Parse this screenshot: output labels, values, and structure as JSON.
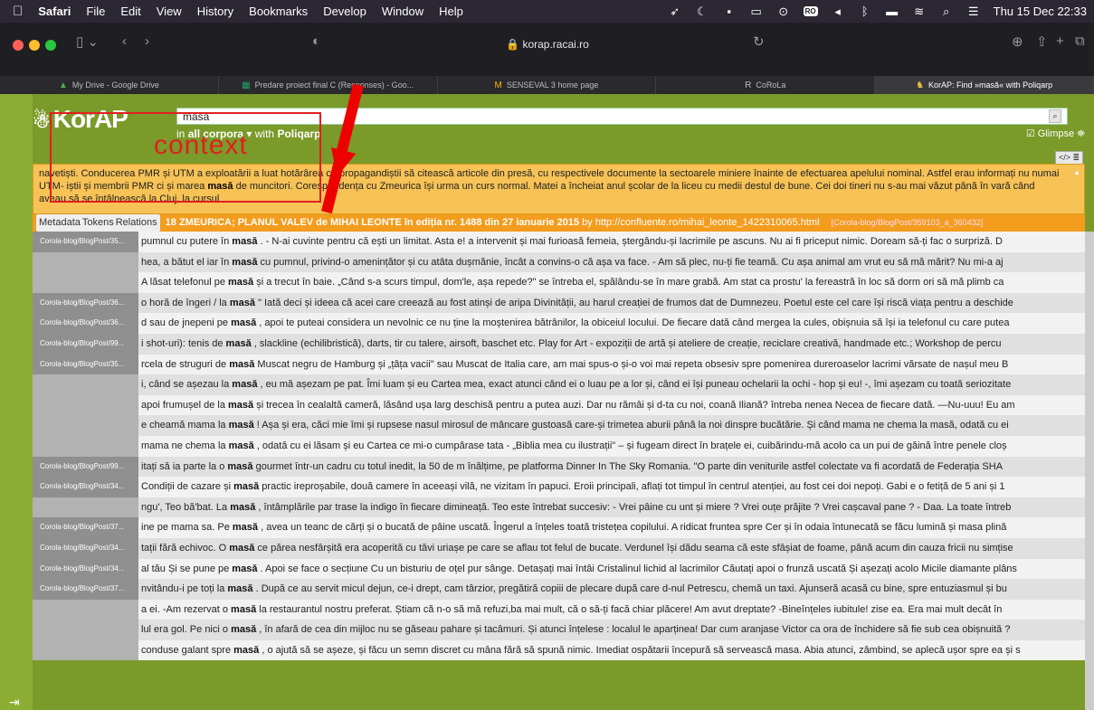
{
  "menubar": {
    "app": "Safari",
    "items": [
      "File",
      "Edit",
      "View",
      "History",
      "Bookmarks",
      "Develop",
      "Window",
      "Help"
    ],
    "clock": "Thu 15 Dec 22:33",
    "ro_badge": "RO"
  },
  "browser": {
    "url": "korap.racai.ro",
    "tabs": [
      {
        "label": "My Drive - Google Drive",
        "icon": "drive-icon"
      },
      {
        "label": "Predare proiect final C (Responses) - Goo...",
        "icon": "sheet-icon"
      },
      {
        "label": "SENSEVAL 3 home page",
        "icon": "mail-icon"
      },
      {
        "label": "CoRoLa",
        "icon": "r-icon"
      },
      {
        "label": "KorAP: Find »masă« with Poliqarp",
        "icon": "korap-icon"
      }
    ]
  },
  "korap": {
    "logo": "KorAP",
    "search_value": "masă",
    "vc_prefix": "in",
    "vc_label": "all corpora",
    "vc_with": "with",
    "query_lang": "Poliqarp",
    "glimpse": "Glimpse",
    "annotation_label": "context",
    "context_text_pre": "navetiști. Conducerea PMR și UTM a exploatării a luat hotărârea ca propagandiștii să citească articole din presă, cu respectivele documente la sectoarele miniere înainte de efectuarea apelului nominal. Astfel erau informați nu numai UTM- iștii și membrii PMR ci și marea ",
    "context_match": "masă",
    "context_text_post": " de muncitori. Corespondența cu Zmeurica își urma un curs normal. Matei a încheiat anul școlar de la liceu cu medii destul de bune. Cei doi tineri nu s-au mai văzut până în vară când aveau să se întâlnească la Cluj, la cursul",
    "doc_buttons": [
      "Metadata",
      "Tokens",
      "Relations"
    ],
    "doc_title": "18 ZMEURICA; PLANUL VALEV de MIHAI LEONTE în ediția nr. 1488 din 27 ianuarie 2015",
    "doc_by": "by http://confluente.ro/mihai_leonte_1422310065.html",
    "doc_id": "[Corola-blog/BlogPost/359103_a_360432]",
    "rows": [
      {
        "label": "Corola-blog/BlogPost/35...",
        "pre": "pumnul cu putere în ",
        "kw": "masă",
        "post": " . - N-ai cuvinte pentru că ești un limitat. Asta e! a intervenit și mai furioasă femeia, ștergându-și lacrimile pe ascuns. Nu ai fi priceput nimic. Doream să-ți fac o surpriză. D"
      },
      {
        "label": "",
        "pre": "hea, a bătut el iar în ",
        "kw": "masă",
        "post": " cu pumnul, privind-o amenințător și cu atâta dușmănie, încât a convins-o că așa va face. - Am să plec, nu-ți fie teamă. Cu așa animal am vrut eu să mă mărit? Nu mi-a aj"
      },
      {
        "label": "",
        "pre": "A lăsat telefonul pe ",
        "kw": "masă",
        "post": " și a trecut în baie. „Când s-a scurs timpul, dom'le, așa repede?\" se întreba el, spălându-se în mare grabă. Am stat ca prostu' la fereastră în loc să dorm ori să mă plimb ca"
      },
      {
        "label": "Corola-blog/BlogPost/36...",
        "pre": "o horă de îngeri / la ",
        "kw": "masă",
        "post": " \" Iată deci și ideea că acei care creează au fost atinși de aripa Divinității, au harul creației de frumos dat de Dumnezeu. Poetul este cel care își riscă viața pentru a deschide"
      },
      {
        "label": "Corola-blog/BlogPost/36...",
        "pre": "d sau de jnepeni pe ",
        "kw": "masă",
        "post": " , apoi te puteai considera un nevolnic ce nu ține la moștenirea bătrânilor, la obiceiul locului. De fiecare dată când mergea la cules, obișnuia să își ia telefonul cu care putea"
      },
      {
        "label": "Corola-blog/BlogPost/99...",
        "pre": "i shot-uri): tenis de ",
        "kw": "masă",
        "post": " , slackline (echilibristică), darts, tir cu talere, airsoft, baschet etc. Play for Art - expoziții de artă și ateliere de creație, reciclare creativă, handmade etc.; Workshop de percu"
      },
      {
        "label": "Corola-blog/BlogPost/35...",
        "pre": "rcela de struguri de ",
        "kw": "masă",
        "post": " Muscat negru de Hamburg și „țâța vacii\" sau Muscat de Italia care, am mai spus-o și-o voi mai repeta obsesiv spre pomenirea dureroaselor lacrimi vărsate de nașul meu B"
      },
      {
        "label": "",
        "pre": "i, când se așezau la ",
        "kw": "masă",
        "post": " , eu mă așezam pe pat. Îmi luam și eu Cartea mea, exact atunci când ei o luau pe a lor și, când ei își puneau ochelarii la ochi - hop și eu! -, îmi așezam cu toată seriozitate"
      },
      {
        "label": "",
        "pre": "apoi frumușel de la ",
        "kw": "masă",
        "post": " și trecea în cealaltă cameră, lăsând ușa larg deschisă pentru a putea auzi. Dar nu rămâi și d-ta cu noi, coană Iliană? întreba nenea Necea de fiecare dată. —Nu-uuu! Eu am"
      },
      {
        "label": "",
        "pre": "e cheamă mama la ",
        "kw": "masă",
        "post": " ! Așa și era, căci mie îmi și rupsese nasul mirosul de mâncare gustoasă care-și trimetea aburii până la noi dinspre bucătărie. Și când mama ne chema la masă, odată cu ei"
      },
      {
        "label": "",
        "pre": "mama ne chema la ",
        "kw": "masă",
        "post": " , odată cu ei lăsam și eu Cartea ce mi-o cumpărase tata - „Biblia mea cu ilustrații\" – și fugeam direct în brațele ei, cuibărindu-mă acolo ca un pui de găină între penele cloș"
      },
      {
        "label": "Corola-blog/BlogPost/99...",
        "pre": "itați să ia parte la o ",
        "kw": "masă",
        "post": " gourmet într-un cadru cu totul inedit, la 50 de m înălțime, pe platforma Dinner In The Sky Romania. \"O parte din veniturile astfel colectate va fi acordată de Federația SHA"
      },
      {
        "label": "Corola-blog/BlogPost/34...",
        "pre": "Condiții de cazare și ",
        "kw": "masă",
        "post": " practic ireproșabile, două camere în aceeași vilă, ne vizitam în papuci. Eroii principali, aflați tot timpul în centrul atenției, au fost cei doi nepoți. Gabi e o fetiță de 5 ani și 1"
      },
      {
        "label": "",
        "pre": "ngu', Teo bă'bat. La ",
        "kw": "masă",
        "post": " , întâmplările par trase la indigo în fiecare dimineață. Teo este întrebat succesiv: - Vrei pâine cu unt și miere ? Vrei ouțe prăjite ? Vrei cașcaval pane ? - Daa. La toate întreb"
      },
      {
        "label": "Corola-blog/BlogPost/37...",
        "pre": "ine pe mama sa. Pe ",
        "kw": "masă",
        "post": " , avea un teanc de cărți și o bucată de pâine uscată. Îngerul a înțeles toată tristețea copilului. A ridicat fruntea spre Cer și în odaia întunecată se făcu lumină și masa plină"
      },
      {
        "label": "Corola-blog/BlogPost/34...",
        "pre": "tații fără echivoc. O ",
        "kw": "masă",
        "post": " ce părea nesfârșită era acoperită cu tăvi uriașe pe care se aflau tot felul de bucate. Verdunel își dădu seama că este sfâșiat de foame, până acum din cauza fricii nu simțise"
      },
      {
        "label": "Corola-blog/BlogPost/34...",
        "pre": "al tău Și se pune pe ",
        "kw": "masă",
        "post": " . Apoi se face o secțiune Cu un bisturiu de oțel pur sânge. Detașați mai întâi Cristalinul lichid al lacrimilor Căutați apoi o frunză uscată Și așezați acolo Micile diamante plâns"
      },
      {
        "label": "Corola-blog/BlogPost/37...",
        "pre": "nvitându-i pe toți la ",
        "kw": "masă",
        "post": " . După ce au servit micul dejun, ce-i drept, cam târzior, pregătiră copiii de plecare după care d-nul Petrescu, chemă un taxi. Ajunseră acasă cu bine, spre entuziasmul și bu"
      },
      {
        "label": "",
        "pre": "a ei. -Am rezervat o ",
        "kw": "masă",
        "post": " la restaurantul nostru preferat. Știam că n-o să mă refuzi,ba mai mult, că o să-ți facă chiar plăcere! Am avut dreptate? -Bineînțeles iubitule! zise ea. Era mai mult decât în"
      },
      {
        "label": "",
        "pre": "lul era gol. Pe nici o ",
        "kw": "masă",
        "post": " , în afară de cea din mijloc nu se găseau pahare și tacâmuri. Și atunci înțelese : localul le aparținea! Dar cum aranjase Victor ca ora de închidere să fie sub cea obișnuită ?"
      },
      {
        "label": "",
        "pre": "conduse galant spre ",
        "kw": "masă",
        "post": " , o ajută să se așeze, și făcu un semn discret cu mâna fără să spună nimic. Imediat ospătarii începură să servească masa. Abia atunci, zâmbind, se aplecă ușor spre ea și s"
      }
    ]
  },
  "colors": {
    "korap_green": "#7a9a29",
    "context_orange": "#f7c256",
    "doc_orange": "#f39c1e",
    "annotation_red": "#e02020"
  }
}
